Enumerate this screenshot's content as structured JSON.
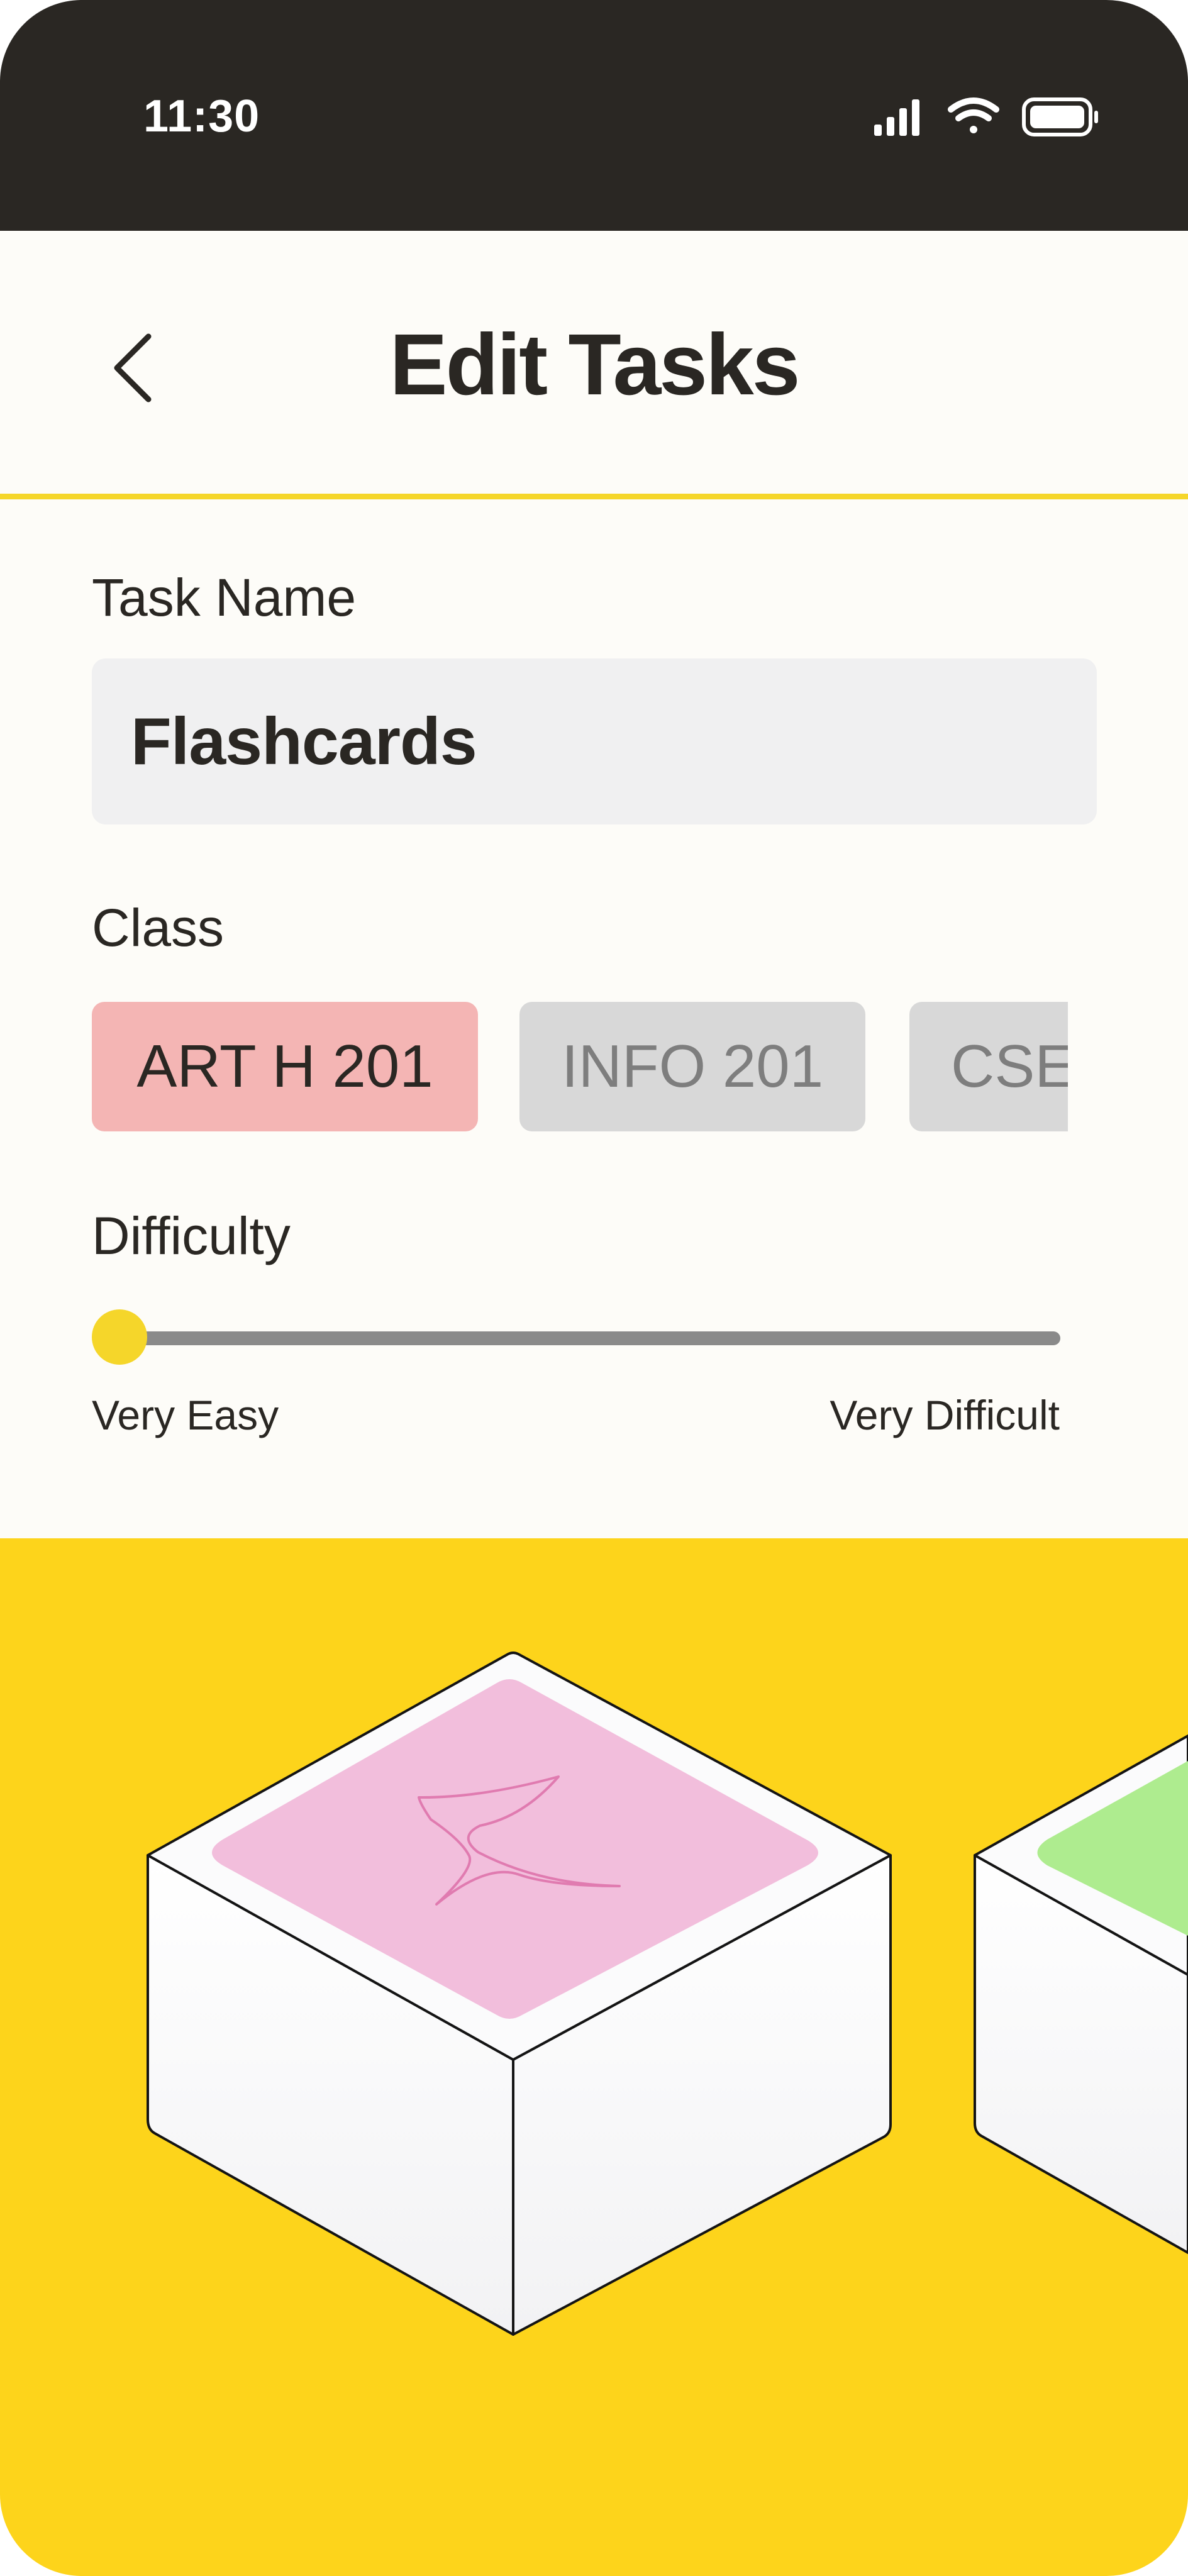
{
  "status_bar": {
    "time": "11:30",
    "icons": [
      "signal-icon",
      "wifi-icon",
      "battery-icon"
    ]
  },
  "header": {
    "back_icon": "chevron-left-icon",
    "title": "Edit Tasks"
  },
  "form": {
    "task_name": {
      "label": "Task Name",
      "value": "Flashcards"
    },
    "class": {
      "label": "Class",
      "options": [
        {
          "label": "ART H 201",
          "selected": true
        },
        {
          "label": "INFO 201",
          "selected": false
        },
        {
          "label": "CSE",
          "selected": false
        }
      ]
    },
    "difficulty": {
      "label": "Difficulty",
      "value_fraction": 0.0,
      "min_label": "Very Easy",
      "max_label": "Very Difficult"
    }
  },
  "illustration": {
    "icons": [
      "sparkle-icon"
    ]
  },
  "colors": {
    "status_bar_bg": "#2A2723",
    "page_bg": "#FDFCF8",
    "accent_yellow": "#F5D62A",
    "illustration_bg": "#FDD41B",
    "chip_selected": "#F4B5B4",
    "chip_unselected": "#D8D8D8",
    "input_bg": "#F0F0F1",
    "box_top_pink": "#F2BEDC",
    "box_top_green": "#AEEC8F",
    "sparkle_stroke": "#E07BB0"
  }
}
